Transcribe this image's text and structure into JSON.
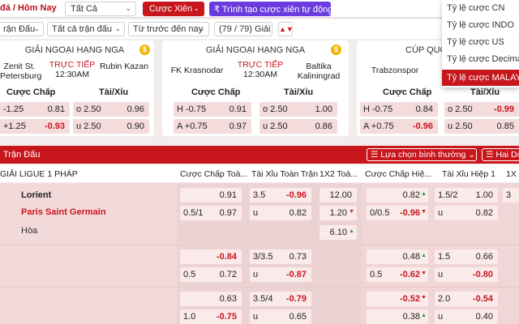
{
  "topbar": {
    "breadcrumb": "đá / Hôm Nay",
    "filter_all": "Tất Cả",
    "btn_cuoc_xien": "Cược Xiên",
    "btn_tao_xien": "Trình tạo cược xiên tự động"
  },
  "filters": {
    "tran_dau": "rận Đấu",
    "tat_ca_tran": "Tất cả trận đấu",
    "tu_truoc": "Từ trước đến nay",
    "giai_count": "(79 / 79) Giải"
  },
  "cards": [
    {
      "league": "GIẢI NGOẠI HẠNG NGA",
      "home": "Zenit St. Petersburg",
      "away": "Rubin Kazan",
      "live": "TRỰC TIẾP",
      "time": "12:30AM",
      "hdr_chap": "Cược Chấp",
      "hdr_taixiu": "Tài/Xỉu",
      "rows": [
        {
          "c_lab": "-1.25",
          "c_val": "0.81",
          "t_lab": "o 2.50",
          "t_val": "0.96"
        },
        {
          "c_lab": "+1.25",
          "c_val": "-0.93",
          "t_lab": "u 2.50",
          "t_val": "0.90"
        }
      ]
    },
    {
      "league": "GIẢI NGOẠI HẠNG NGA",
      "home": "FK Krasnodar",
      "away": "Baltika Kaliningrad",
      "live": "TRỰC TIẾP",
      "time": "12:30AM",
      "hdr_chap": "Cược Chấp",
      "hdr_taixiu": "Tài/Xỉu",
      "rows": [
        {
          "c_lab": "H -0.75",
          "c_val": "0.91",
          "t_lab": "o 2.50",
          "t_val": "1.00"
        },
        {
          "c_lab": "A +0.75",
          "c_val": "0.97",
          "t_lab": "u 2.50",
          "t_val": "0.86"
        }
      ]
    },
    {
      "league": "CÚP QUỐC G",
      "home": "Trabzonspor",
      "away": "",
      "live": "",
      "time": "",
      "hdr_chap": "Cược Chấp",
      "hdr_taixiu": "Tài/Xỉu",
      "rows": [
        {
          "c_lab": "H -0.75",
          "c_val": "0.84",
          "t_lab": "o 2.50",
          "t_val": "-0.99"
        },
        {
          "c_lab": "A +0.75",
          "c_val": "-0.96",
          "t_lab": "u 2.50",
          "t_val": "0.85"
        }
      ]
    }
  ],
  "dropdown": {
    "items": [
      "Tỷ lệ cược CN",
      "Tỷ lệ cược INDO",
      "Tỷ lệ cược US",
      "Tỷ lệ cược Decimal",
      "Tỷ lệ cược MALAY"
    ],
    "active_index": 4
  },
  "main": {
    "title": "Trận Đấu",
    "choose": "Lựa chọn bình thường",
    "haido": "Hai Dò"
  },
  "columns": {
    "league": "GIẢI LIGUE 1 PHÁP",
    "c1": "Cược Chấp Toà...",
    "c2": "Tài Xỉu Toàn Trận",
    "c3": "1X2 Toà...",
    "c4": "Cược Chấp Hiệ...",
    "c5": "Tài Xỉu Hiệp 1",
    "c6": "1X"
  },
  "match": {
    "home": "Lorient",
    "away": "Paris Saint Germain",
    "draw": "Hòa"
  },
  "odds": {
    "r1": {
      "a1": "0.91",
      "b_lab": "3.5",
      "b1": "-0.96",
      "x1": "12.00",
      "d1": "0.82",
      "e_lab": "1.5/2",
      "e1": "1.00",
      "f1": "3"
    },
    "r2": {
      "a_lab": "0.5/1",
      "a2": "0.97",
      "b_lab": "u",
      "b2": "0.82",
      "x2": "1.20",
      "d_lab": "0/0.5",
      "d2": "-0.96",
      "e_lab": "u",
      "e2": "0.82"
    },
    "r3": {
      "x3": "6.10"
    },
    "r4": {
      "a1": "-0.84",
      "b_lab": "3/3.5",
      "b1": "0.73",
      "d1": "0.48",
      "e_lab": "1.5",
      "e1": "0.66"
    },
    "r5": {
      "a_lab": "0.5",
      "a2": "0.72",
      "b_lab": "u",
      "b2": "-0.87",
      "d_lab": "0.5",
      "d2": "-0.62",
      "e_lab": "u",
      "e2": "-0.80"
    },
    "r6": {
      "a1": "0.63",
      "b_lab": "3.5/4",
      "b1": "-0.79",
      "d1": "-0.52",
      "e_lab": "2.0",
      "e1": "-0.54"
    },
    "r7": {
      "a_lab": "1.0",
      "a2": "-0.75",
      "b_lab": "u",
      "b2": "0.65",
      "d2": "0.38",
      "e_lab": "u",
      "e2": "0.40"
    }
  },
  "colors": {
    "brand_red": "#c8161d",
    "purple": "#6a3ce0",
    "pink_cell": "#f4dcdc"
  }
}
